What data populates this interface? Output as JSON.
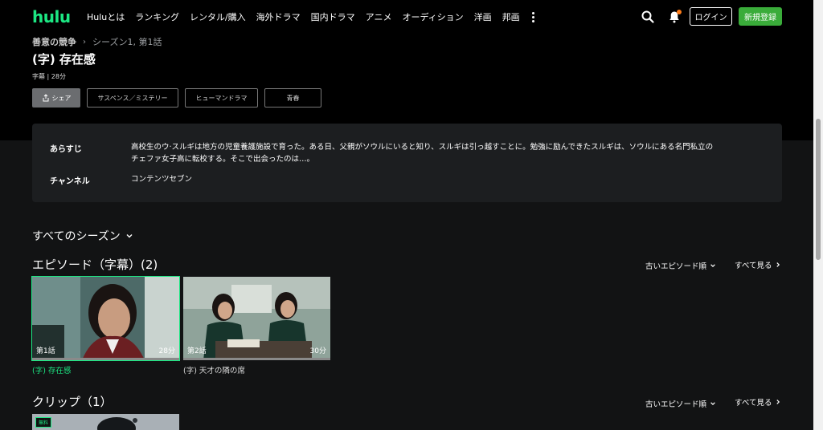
{
  "header": {
    "logo": "hulu",
    "nav": [
      "Huluとは",
      "ランキング",
      "レンタル/購入",
      "海外ドラマ",
      "国内ドラマ",
      "アニメ",
      "オーディション",
      "洋画",
      "邦画"
    ],
    "login": "ログイン",
    "signup": "新規登録",
    "accent": "#1ce783",
    "notification_dot_color": "#ff7d1a"
  },
  "breadcrumb": {
    "series": "善意の競争",
    "separator": "›",
    "episode": "シーズン1, 第1話"
  },
  "episode": {
    "title": "(字) 存在感",
    "meta": "字幕 | 28分"
  },
  "buttons": {
    "share": "シェア",
    "genres": [
      "サスペンス／ミステリー",
      "ヒューマンドラマ",
      "青春"
    ]
  },
  "info": {
    "synopsis_label": "あらすじ",
    "synopsis_line1": "高校生のウ·スルギは地方の児童養護施設で育った。ある日、父親がソウルにいると知り、スルギは引っ越すことに。勉強に励んできたスルギは、ソウルにある名門私立の",
    "synopsis_line2": "チェファ女子高に転校する。そこで出会ったのは…。",
    "channel_label": "チャンネル",
    "channel": "コンテンツセブン"
  },
  "seasons": {
    "label": "すべてのシーズン"
  },
  "episodes_section": {
    "title": "エピソード（字幕）(2)",
    "sort": "古いエピソード順",
    "see_all": "すべて見る",
    "items": [
      {
        "number": "第1話",
        "duration": "28分",
        "caption": "(字) 存在感",
        "active": true
      },
      {
        "number": "第2話",
        "duration": "30分",
        "caption": "(字) 天才の隣の席",
        "active": false
      }
    ]
  },
  "clips_section": {
    "title": "クリップ（1）",
    "sort": "古いエピソード順",
    "see_all": "すべて見る",
    "badge": "無料"
  }
}
